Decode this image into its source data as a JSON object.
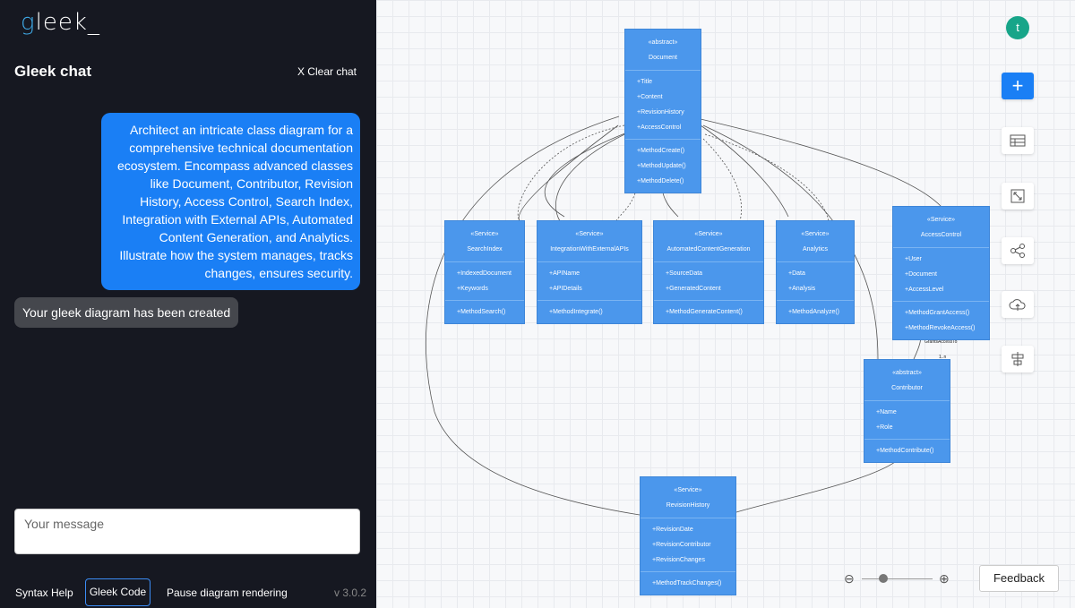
{
  "app": {
    "logo": "gleek_",
    "chat_title": "Gleek chat",
    "clear_chat": "X Clear chat"
  },
  "messages": [
    {
      "role": "user",
      "text": "Architect an intricate class diagram for a comprehensive technical documentation ecosystem. Encompass advanced classes like Document, Contributor, Revision History, Access Control, Search Index, Integration with External APIs, Automated Content Generation, and Analytics. Illustrate how the system manages, tracks changes, ensures security."
    },
    {
      "role": "bot",
      "text": "Your gleek diagram has been created"
    }
  ],
  "input": {
    "placeholder": "Your message",
    "value": ""
  },
  "footer": {
    "syntax_help": "Syntax Help",
    "gleek_code": "Gleek Code",
    "pause": "Pause diagram rendering",
    "version": "v 3.0.2"
  },
  "user_avatar": "t",
  "feedback": "Feedback",
  "zoom": {
    "level": 0.3
  },
  "toolbar": [
    "add-icon",
    "table-icon",
    "fit-icon",
    "share-icon",
    "cloud-icon",
    "align-icon"
  ],
  "colors": {
    "class_fill": "#4b97ec",
    "chat_user": "#1a7ff5",
    "panel_bg": "#161821"
  },
  "classes": [
    {
      "id": "document",
      "stereotype": "«abstract»",
      "name": "Document",
      "attributes": [
        "+Title",
        "+Content",
        "+RevisionHistory",
        "+AccessControl"
      ],
      "methods": [
        "+MethodCreate()",
        "+MethodUpdate()",
        "+MethodDelete()"
      ]
    },
    {
      "id": "searchindex",
      "stereotype": "«Service»",
      "name": "SearchIndex",
      "attributes": [
        "+IndexedDocument",
        "+Keywords"
      ],
      "methods": [
        "+MethodSearch()"
      ]
    },
    {
      "id": "integration",
      "stereotype": "«Service»",
      "name": "IntegrationWithExternalAPIs",
      "attributes": [
        "+APIName",
        "+APIDetails"
      ],
      "methods": [
        "+MethodIntegrate()"
      ]
    },
    {
      "id": "autogen",
      "stereotype": "«Service»",
      "name": "AutomatedContentGeneration",
      "attributes": [
        "+SourceData",
        "+GeneratedContent"
      ],
      "methods": [
        "+MethodGenerateContent()"
      ]
    },
    {
      "id": "analytics",
      "stereotype": "«Service»",
      "name": "Analytics",
      "attributes": [
        "+Data",
        "+Analysis"
      ],
      "methods": [
        "+MethodAnalyze()"
      ]
    },
    {
      "id": "accesscontrol",
      "stereotype": "«Service»",
      "name": "AccessControl",
      "attributes": [
        "+User",
        "+Document",
        "+AccessLevel"
      ],
      "methods": [
        "+MethodGrantAccess()",
        "+MethodRevokeAccess()"
      ]
    },
    {
      "id": "contributor",
      "stereotype": "«abstract»",
      "name": "Contributor",
      "attributes": [
        "+Name",
        "+Role"
      ],
      "methods": [
        "+MethodContribute()"
      ]
    },
    {
      "id": "revisionhistory",
      "stereotype": "«Service»",
      "name": "RevisionHistory",
      "attributes": [
        "+RevisionDate",
        "+RevisionContributor",
        "+RevisionChanges"
      ],
      "methods": [
        "+MethodTrackChanges()"
      ]
    }
  ],
  "relation": {
    "label": "GrantsAccessTo",
    "from_mult": "1",
    "to_mult": "1..n"
  }
}
